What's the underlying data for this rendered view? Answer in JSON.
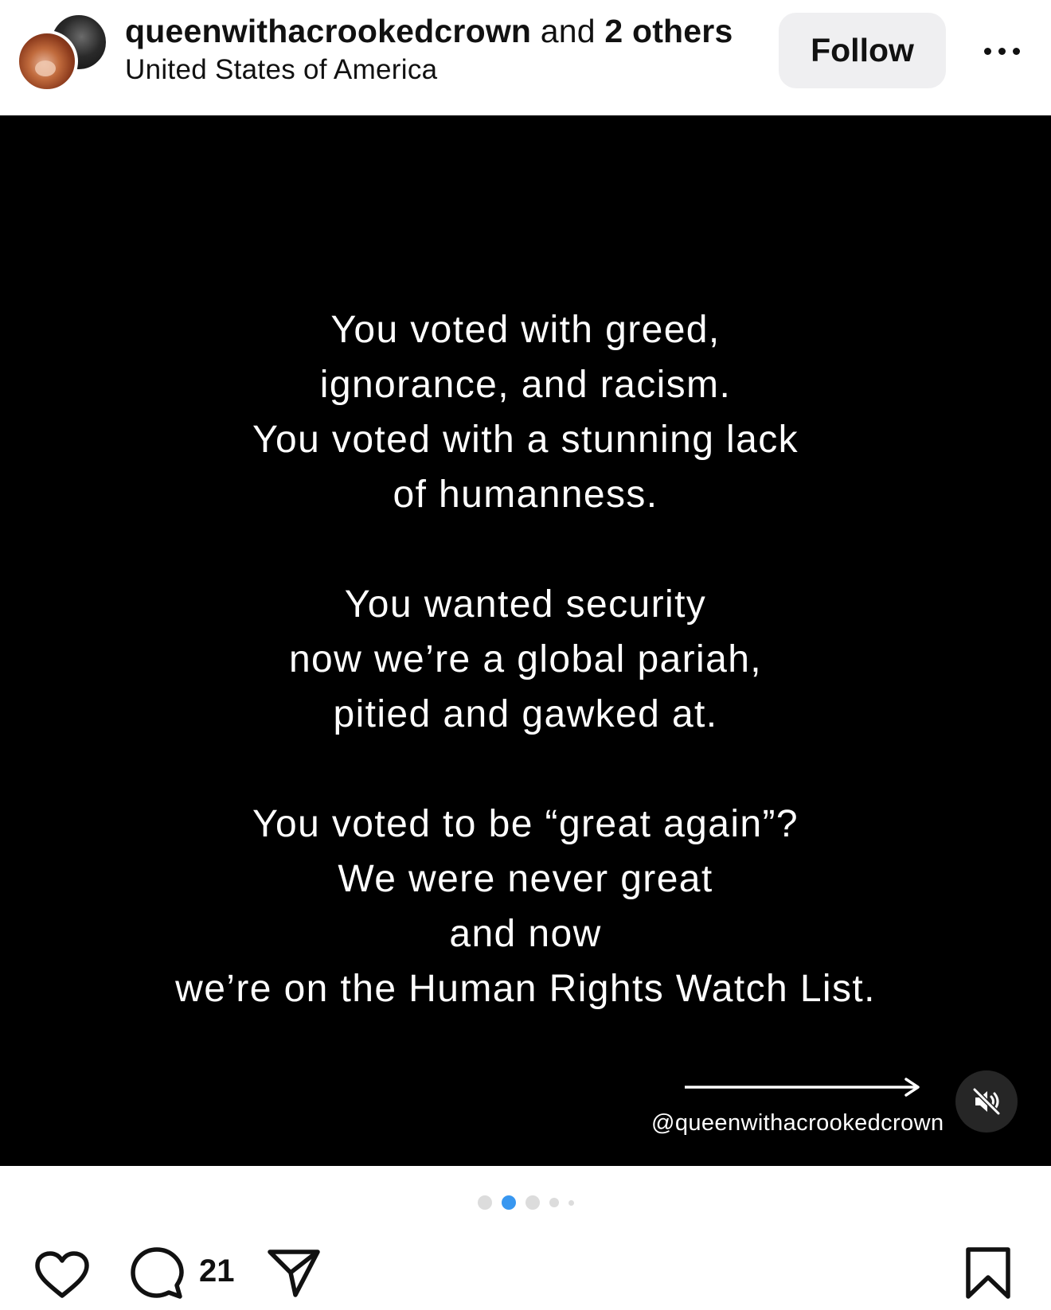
{
  "header": {
    "username": "queenwithacrookedcrown",
    "coauthor_connector": "and",
    "others": "2 others",
    "location": "United States of America",
    "follow_label": "Follow",
    "more_icon": "more-horizontal-icon"
  },
  "post": {
    "paragraphs": [
      {
        "lines": [
          "You voted with greed,",
          "ignorance, and racism.",
          "You voted with a stunning lack",
          "of humanness."
        ]
      },
      {
        "lines": [
          "You wanted security",
          "now we’re a global pariah,",
          "pitied and gawked at."
        ]
      },
      {
        "lines": [
          "You voted to be “great again”?",
          "We were never great",
          "and now",
          "we’re on the Human Rights Watch List."
        ]
      }
    ],
    "watermark": "@queenwithacrookedcrown",
    "arrow_icon": "arrow-right-icon",
    "mute_icon": "volume-muted-icon"
  },
  "carousel": {
    "total": 5,
    "active_index": 1,
    "active_color": "#3897f0",
    "inactive_color": "#dcdcdc"
  },
  "actions": {
    "like_icon": "heart-icon",
    "comment_icon": "comment-icon",
    "comment_count": "21",
    "share_icon": "send-icon",
    "save_icon": "bookmark-icon"
  }
}
